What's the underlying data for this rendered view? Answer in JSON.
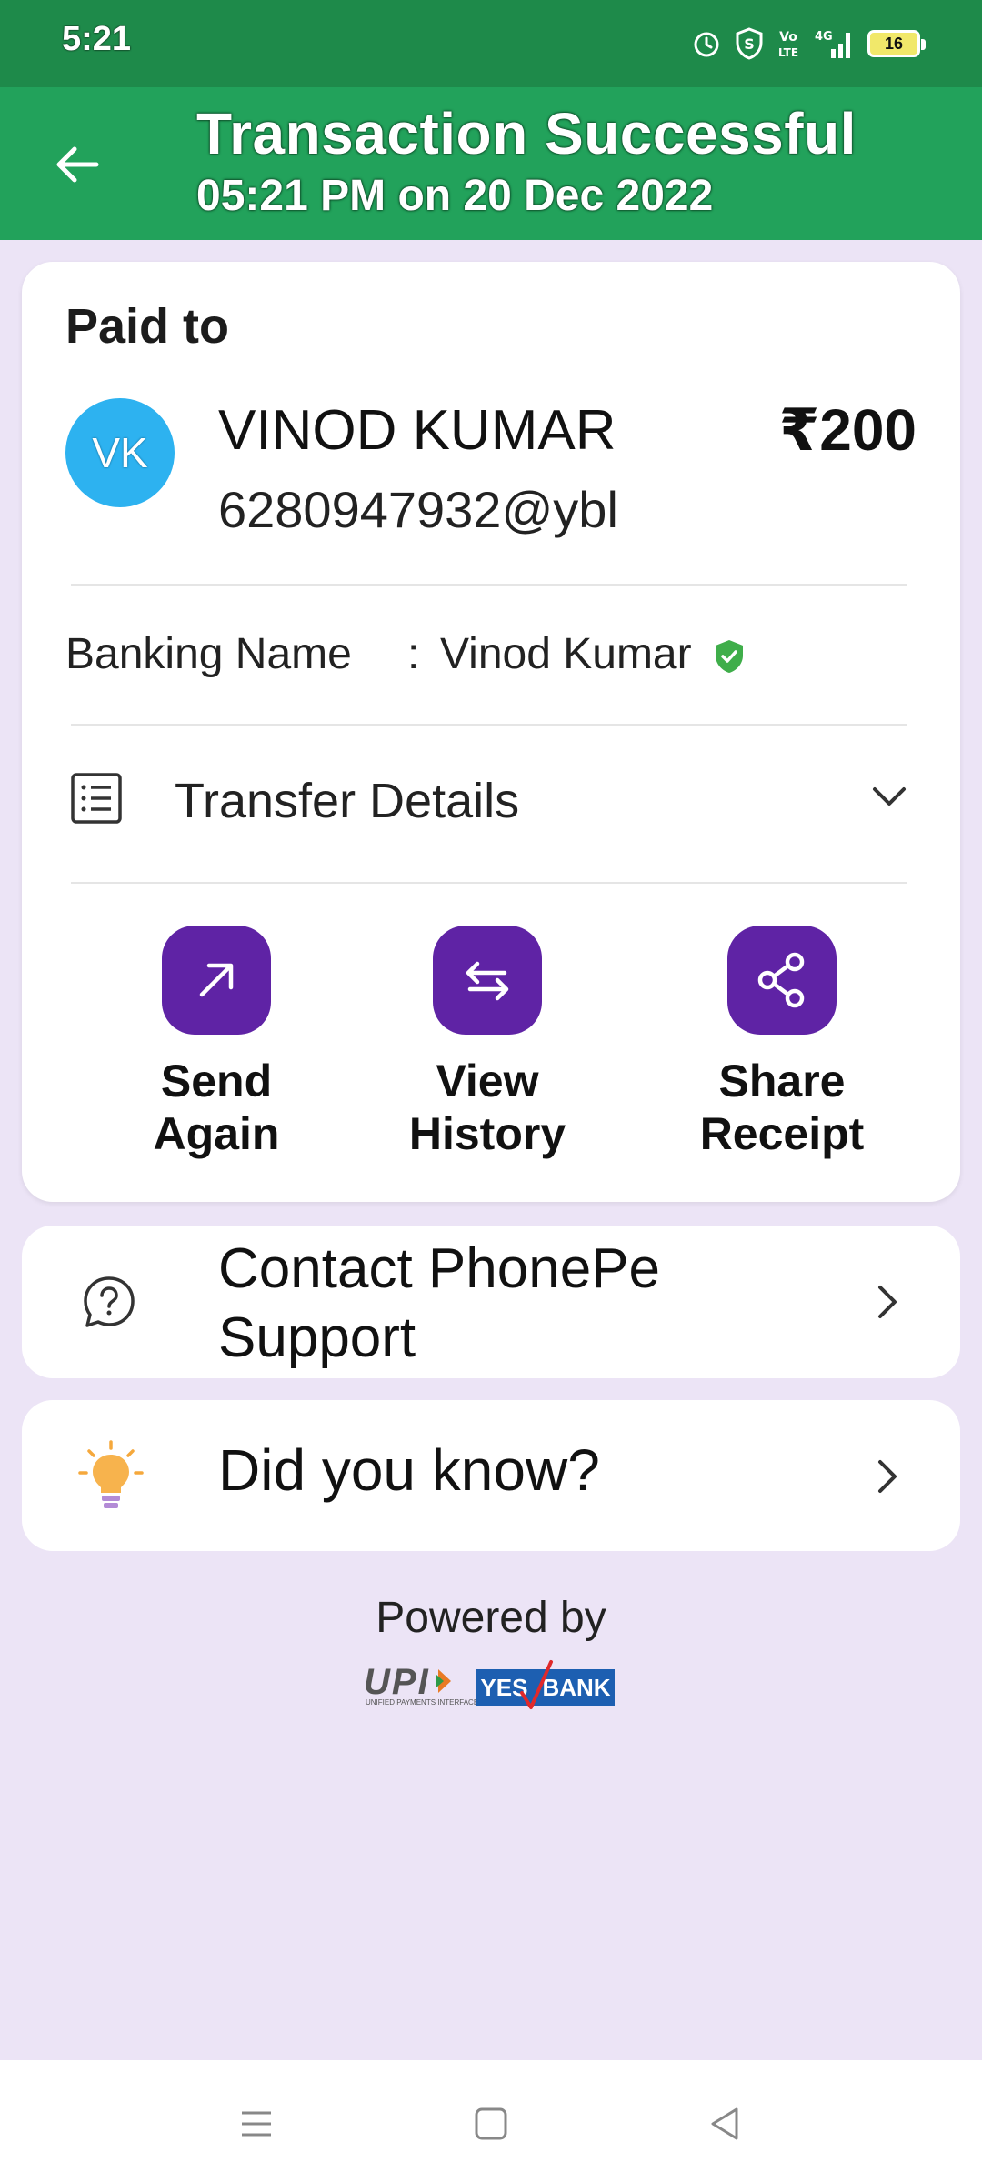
{
  "status_bar": {
    "time": "5:21",
    "battery_level": "16",
    "network": "4G",
    "icons": [
      "alarm-icon",
      "shield-icon",
      "volte-icon",
      "signal-icon",
      "battery-icon"
    ]
  },
  "header": {
    "title": "Transaction Successful",
    "subtitle": "05:21 PM on 20 Dec 2022",
    "background": "#22a25b"
  },
  "payment": {
    "paid_to_label": "Paid to",
    "avatar_initials": "VK",
    "payee_name": "VINOD KUMAR",
    "payee_upi": "6280947932@ybl",
    "amount": "₹200",
    "banking_name_label": "Banking Name",
    "banking_name_separator": ":",
    "banking_name_value": "Vinod Kumar",
    "transfer_details_label": "Transfer Details"
  },
  "actions": [
    {
      "line1": "Send",
      "line2": "Again",
      "icon": "arrow-up-right-icon"
    },
    {
      "line1": "View",
      "line2": "History",
      "icon": "swap-arrows-icon"
    },
    {
      "line1": "Share",
      "line2": "Receipt",
      "icon": "share-icon"
    }
  ],
  "support": {
    "label_line1": "Contact PhonePe",
    "label_line2": "Support"
  },
  "did_you_know": {
    "label": "Did you know?"
  },
  "footer": {
    "powered_by": "Powered by",
    "upi_text": "UPI",
    "upi_subtext": "UNIFIED PAYMENTS INTERFACE",
    "bank_word1": "YES",
    "bank_word2": "BANK"
  },
  "colors": {
    "accent_purple": "#5f23a5",
    "success_green": "#22a25b",
    "page_bg": "#ece4f6",
    "avatar_blue": "#2db2f0"
  }
}
